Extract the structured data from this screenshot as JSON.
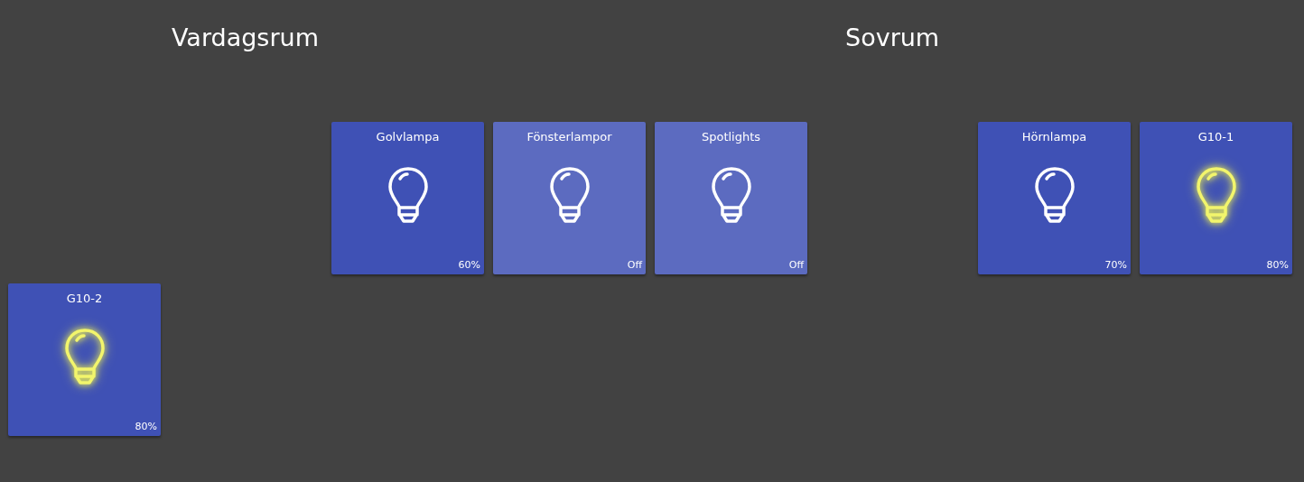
{
  "rooms": [
    {
      "name": "Vardagsrum",
      "devices": [
        {
          "name": "Golvlampa",
          "on": true,
          "glowing": false,
          "reading": "60%"
        },
        {
          "name": "Fönsterlampor",
          "on": false,
          "glowing": false,
          "reading": "Off"
        },
        {
          "name": "Spotlights",
          "on": false,
          "glowing": false,
          "reading": "Off"
        }
      ]
    },
    {
      "name": "Sovrum",
      "devices": [
        {
          "name": "Hörnlampa",
          "on": true,
          "glowing": false,
          "reading": "70%"
        },
        {
          "name": "G10-1",
          "on": true,
          "glowing": true,
          "reading": "80%"
        }
      ]
    }
  ],
  "other_devices": [
    {
      "name": "G10-2",
      "on": true,
      "glowing": true,
      "reading": "80%"
    }
  ]
}
